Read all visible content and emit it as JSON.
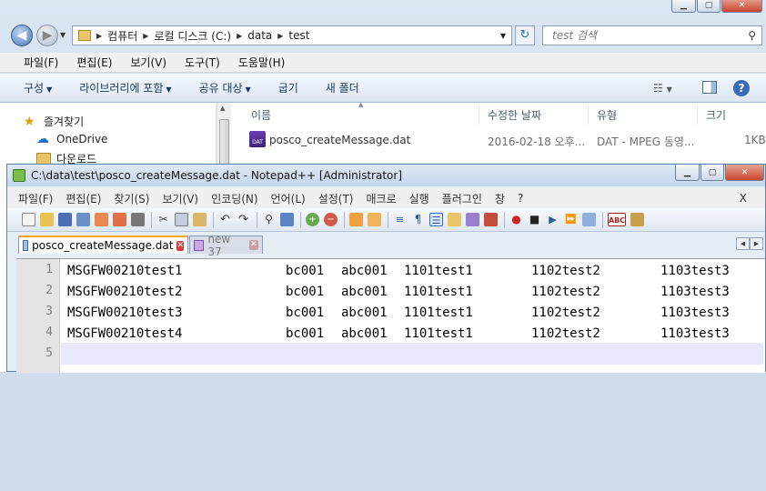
{
  "explorer": {
    "address": {
      "segments": [
        "컴퓨터",
        "로컬 디스크 (C:)",
        "data",
        "test"
      ]
    },
    "search": {
      "placeholder": "test 검색"
    },
    "menu": [
      "파일(F)",
      "편집(E)",
      "보기(V)",
      "도구(T)",
      "도움말(H)"
    ],
    "commands": [
      {
        "label": "구성",
        "dropdown": true
      },
      {
        "label": "라이브러리에 포함",
        "dropdown": true
      },
      {
        "label": "공유 대상",
        "dropdown": true
      },
      {
        "label": "굽기",
        "dropdown": false
      },
      {
        "label": "새 폴더",
        "dropdown": false
      }
    ],
    "nav": [
      "즐겨찾기",
      "OneDrive",
      "다운로드"
    ],
    "columns": [
      "이름",
      "수정한 날짜",
      "유형",
      "크기"
    ],
    "file": {
      "name": "posco_createMessage.dat",
      "icon_label": "DAT",
      "modified": "2016-02-18 오후...",
      "type": "DAT - MPEG 동영...",
      "size": "1KB"
    }
  },
  "notepad": {
    "title": "C:\\data\\test\\posco_createMessage.dat - Notepad++ [Administrator]",
    "menu": [
      "파일(F)",
      "편집(E)",
      "찾기(S)",
      "보기(V)",
      "인코딩(N)",
      "언어(L)",
      "설정(T)",
      "매크로",
      "실행",
      "플러그인",
      "창",
      "?"
    ],
    "menu_close": "X",
    "toolbar_icon_labels": {
      "spellcheck": "ABC"
    },
    "tabs": [
      {
        "label": "posco_createMessage.dat",
        "active": true
      },
      {
        "label": "new 37",
        "active": false
      }
    ],
    "lines": [
      {
        "num": "1",
        "cols": [
          "MSGFW00210test1",
          "bc001",
          "abc001",
          "1101test1",
          "1102test2",
          "1103test3"
        ]
      },
      {
        "num": "2",
        "cols": [
          "MSGFW00210test2",
          "bc001",
          "abc001",
          "1101test1",
          "1102test2",
          "1103test3"
        ]
      },
      {
        "num": "3",
        "cols": [
          "MSGFW00210test3",
          "bc001",
          "abc001",
          "1101test1",
          "1102test2",
          "1103test3"
        ]
      },
      {
        "num": "4",
        "cols": [
          "MSGFW00210test4",
          "bc001",
          "abc001",
          "1101test1",
          "1102test2",
          "1103test3"
        ]
      },
      {
        "num": "5",
        "cols": []
      }
    ]
  }
}
